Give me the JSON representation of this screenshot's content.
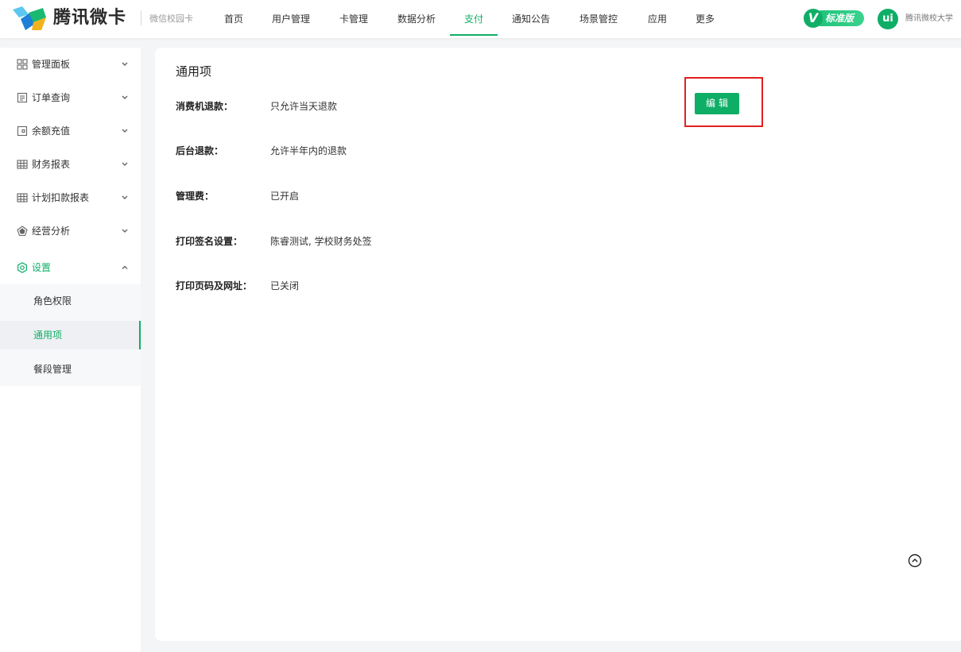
{
  "header": {
    "brand": "腾讯微卡",
    "brand_sub": "微信校园卡",
    "nav": [
      "首页",
      "用户管理",
      "卡管理",
      "数据分析",
      "支付",
      "通知公告",
      "场景管控",
      "应用",
      "更多"
    ],
    "active_nav": "支付",
    "edition_badge": "标准版",
    "edition_letter": "V",
    "university_logo_text": "ui",
    "university_name": "腾讯微校大学",
    "accent_color": "#0fae66"
  },
  "sidebar": {
    "items": [
      {
        "label": "管理面板",
        "icon": "dashboard-icon"
      },
      {
        "label": "订单查询",
        "icon": "order-icon"
      },
      {
        "label": "余额充值",
        "icon": "wallet-icon"
      },
      {
        "label": "财务报表",
        "icon": "table-icon"
      },
      {
        "label": "计划扣款报表",
        "icon": "table-icon"
      },
      {
        "label": "经营分析",
        "icon": "analysis-icon"
      },
      {
        "label": "设置",
        "icon": "settings-icon"
      }
    ],
    "sub_items": [
      "角色权限",
      "通用项",
      "餐段管理"
    ],
    "active_sub": "通用项"
  },
  "main": {
    "title": "通用项",
    "rows": [
      {
        "label": "消费机退款：",
        "value": "只允许当天退款"
      },
      {
        "label": "后台退款：",
        "value": "允许半年内的退款"
      },
      {
        "label": "管理费：",
        "value": "已开启"
      },
      {
        "label": "打印签名设置：",
        "value": "陈睿测试, 学校财务处签"
      },
      {
        "label": "打印页码及网址：",
        "value": "已关闭"
      }
    ],
    "edit_button": "编辑"
  }
}
